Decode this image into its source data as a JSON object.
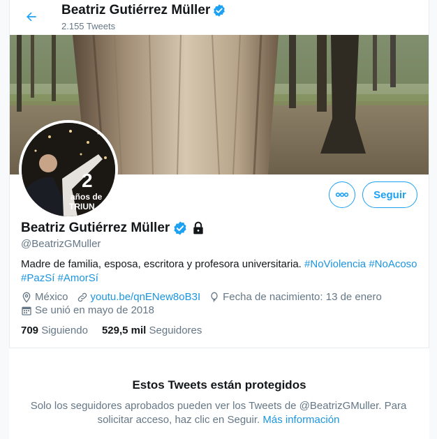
{
  "header": {
    "name": "Beatriz Gutiérrez Müller",
    "tweet_count": "2.155 Tweets"
  },
  "avatar": {
    "badge_number": "2",
    "badge_text_line1": "años de",
    "badge_text_line2": "TRIUN"
  },
  "actions": {
    "follow_label": "Seguir"
  },
  "profile": {
    "name": "Beatriz Gutiérrez Müller",
    "handle": "@BeatrizGMuller",
    "bio_text": "Madre de familia, esposa, escritora y profesora universitaria.",
    "bio_hashtags": [
      "#NoViolencia",
      "#NoAcoso",
      "#PazSí",
      "#AmorSí"
    ],
    "location": "México",
    "website": "youtu.be/qnENew8oB3I",
    "birthday": "Fecha de nacimiento: 13 de enero",
    "joined": "Se unió en mayo de 2018"
  },
  "stats": {
    "following_count": "709",
    "following_label": "Siguiendo",
    "followers_count": "529,5 mil",
    "followers_label": "Seguidores"
  },
  "protected": {
    "title": "Estos Tweets están protegidos",
    "text": "Solo los seguidores aprobados pueden ver los Tweets de @BeatrizGMuller. Para solicitar acceso, haz clic en Seguir.",
    "link": "Más información"
  },
  "colors": {
    "accent": "#1da1f2",
    "text": "#14171a",
    "muted": "#657786"
  },
  "icons": [
    "back-arrow-icon",
    "verified-badge-icon",
    "lock-icon",
    "more-icon",
    "location-icon",
    "link-icon",
    "balloon-icon",
    "calendar-icon"
  ]
}
